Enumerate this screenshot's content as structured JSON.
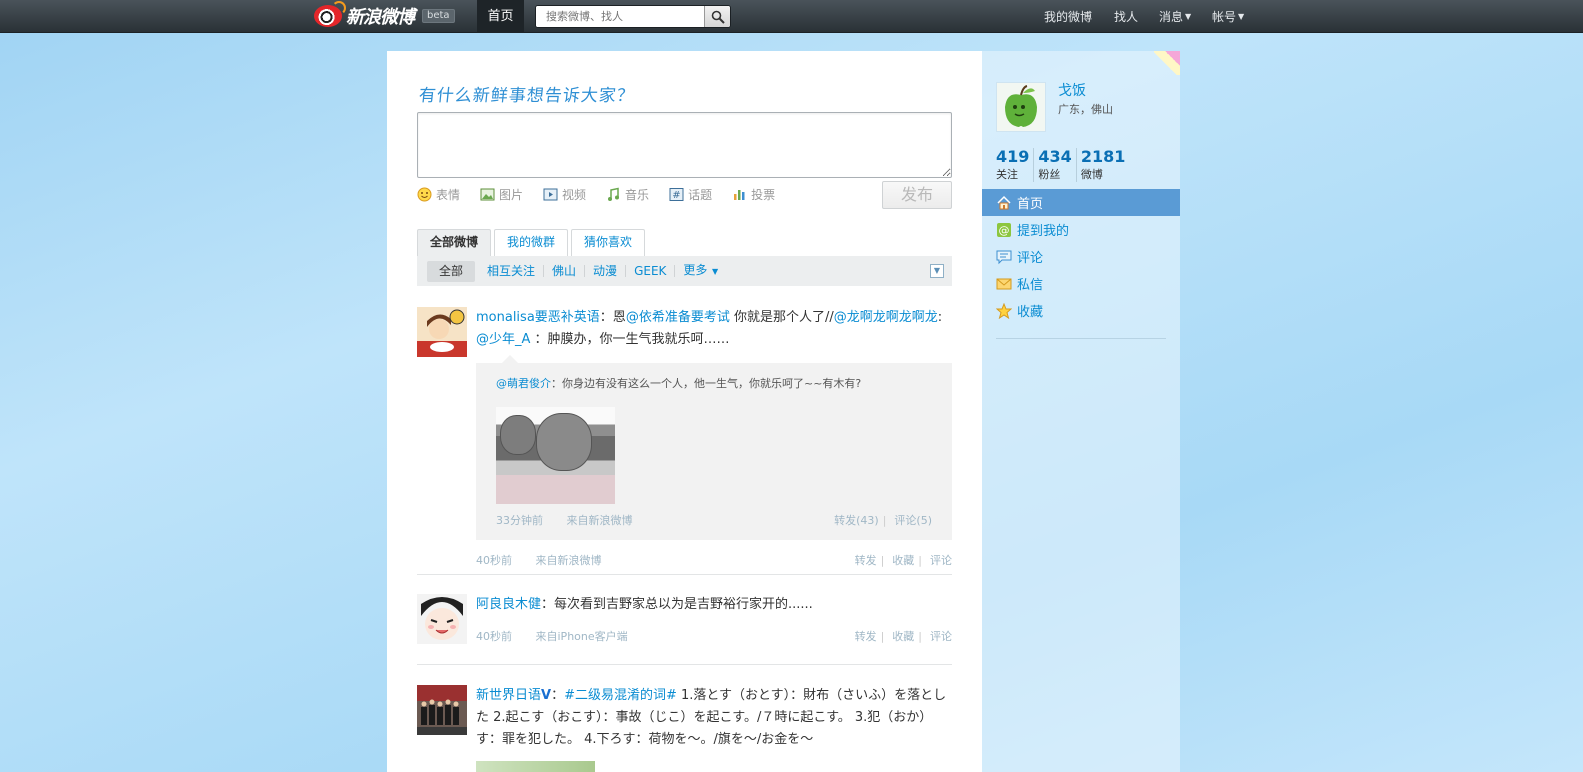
{
  "topbar": {
    "logo_text": "新浪微博",
    "beta": "beta",
    "home": "首页",
    "search_placeholder": "搜索微博、找人",
    "my_weibo": "我的微博",
    "find_people": "找人",
    "messages": "消息",
    "account": "帐号"
  },
  "publisher": {
    "title": "有什么新鲜事想告诉大家？",
    "tools": [
      "表情",
      "图片",
      "视频",
      "音乐",
      "话题",
      "投票"
    ],
    "publish": "发布"
  },
  "tabs": [
    "全部微博",
    "我的微群",
    "猜你喜欢"
  ],
  "filters": [
    "全部",
    "相互关注",
    "佛山",
    "动漫",
    "GEEK",
    "更多"
  ],
  "feed": [
    {
      "user": "monalisa要恶补英语",
      "text_parts": [
        "：恩",
        "@依希准备要考试",
        " 你就是那个人了//",
        "@龙啊龙啊龙啊龙",
        ": ",
        "@少年_A",
        " ：肿膜办，你一生气我就乐呵……"
      ],
      "quote": {
        "user": "@萌君俊介",
        "text": "：你身边有没有这么一个人，他一生气，你就乐呵了~~有木有?",
        "time": "33分钟前",
        "source_prefix": "来自",
        "source": "新浪微博",
        "repost": "转发(43)",
        "comment": "评论(5)"
      },
      "time": "40秒前",
      "source_prefix": "来自",
      "source": "新浪微博",
      "actions": [
        "转发",
        "收藏",
        "评论"
      ]
    },
    {
      "user": "阿良良木健",
      "text": "：每次看到吉野家总以为是吉野裕行家开的......",
      "time": "40秒前",
      "source_prefix": "来自",
      "source": "iPhone客户端",
      "actions": [
        "转发",
        "收藏",
        "评论"
      ]
    },
    {
      "user": "新世界日语",
      "verified": "V",
      "colon": "：",
      "topic": "#二级易混淆的词#",
      "text": " 1.落とす（おとす）：財布（さいふ）を落とした 2.起こす（おこす）：事故（じこ）を起こす。/７時に起こす。 3.犯（おか）す：罪を犯した。 4.下ろす：荷物を～。/旗を～/お金を～"
    }
  ],
  "sidebar": {
    "name": "戈饭",
    "location": "广东，佛山",
    "counts": [
      {
        "num": "419",
        "label": "关注"
      },
      {
        "num": "434",
        "label": "粉丝"
      },
      {
        "num": "2181",
        "label": "微博"
      }
    ],
    "nav": [
      "首页",
      "提到我的",
      "评论",
      "私信",
      "收藏"
    ]
  },
  "colors": {
    "link": "#0a8cd2",
    "topbar": "#2a3136",
    "sidebar_active": "#5a9bd5"
  }
}
